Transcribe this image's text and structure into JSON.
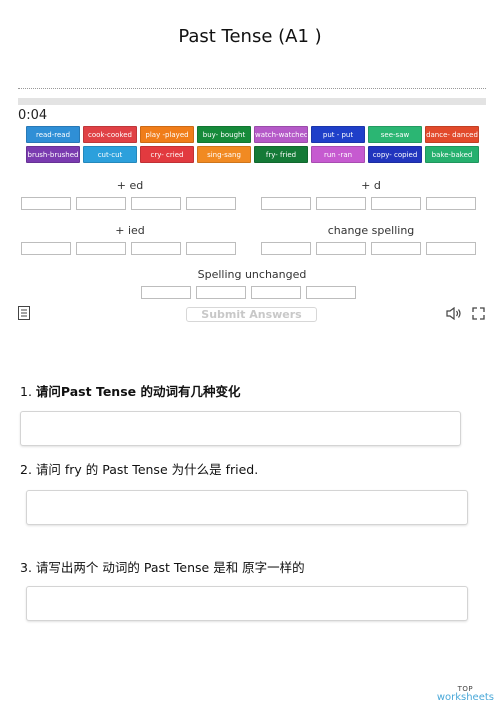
{
  "page": {
    "title": "Past Tense (A1 )"
  },
  "activity": {
    "timer": "0:04",
    "tiles": [
      {
        "label": "read-read",
        "color": "#2f8fd6"
      },
      {
        "label": "cook-cooked",
        "color": "#e04145"
      },
      {
        "label": "play -played",
        "color": "#f07d1a"
      },
      {
        "label": "buy- bought",
        "color": "#168a3a"
      },
      {
        "label": "watch-watched",
        "color": "#b55ac8"
      },
      {
        "label": "put - put",
        "color": "#1f3fc9"
      },
      {
        "label": "see-saw",
        "color": "#2bb673"
      },
      {
        "label": "dance- danced",
        "color": "#e24a2b"
      },
      {
        "label": "brush-brushed",
        "color": "#7a3bb0"
      },
      {
        "label": "cut-cut",
        "color": "#2ca0dc"
      },
      {
        "label": "cry- cried",
        "color": "#e23a3f"
      },
      {
        "label": "sing-sang",
        "color": "#f18a22"
      },
      {
        "label": "fry- fried",
        "color": "#147a37"
      },
      {
        "label": "run -ran",
        "color": "#c65ad0"
      },
      {
        "label": "copy- copied",
        "color": "#2135be"
      },
      {
        "label": "bake-baked",
        "color": "#25b06e"
      }
    ],
    "groups": {
      "ed": "+ ed",
      "d": "+ d",
      "ied": "+ ied",
      "change": "change spelling",
      "unchanged": "Spelling unchanged"
    },
    "submit_label": "Submit Answers"
  },
  "questions": [
    {
      "number": "1.",
      "text": "请问Past Tense 的动词有几种变化"
    },
    {
      "number": "2.",
      "text": "请问 fry 的 Past Tense 为什么是 fried."
    },
    {
      "number": "3.",
      "text": "请写出两个 动词的 Past Tense 是和 原字一样的"
    }
  ],
  "brand": {
    "top": "TOP",
    "main": "worksheets"
  }
}
